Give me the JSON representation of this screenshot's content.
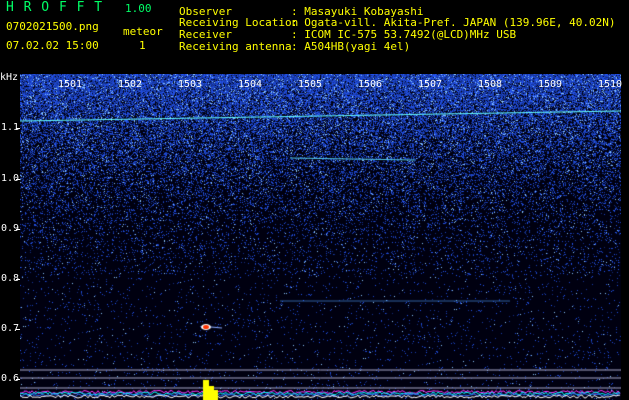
{
  "header": {
    "app_title": "H R O F F T",
    "version": "1.00",
    "filename": "0702021500.png",
    "datetime": "07.02.02 15:00",
    "meteor_label": "meteor",
    "meteor_count": "1",
    "observer_key": "Observer",
    "observer_val": ": Masayuki Kobayashi",
    "location_key": "Receiving Location",
    "location_val": ": Ogata-vill. Akita-Pref. JAPAN (139.96E, 40.02N)",
    "receiver_key": "Receiver",
    "receiver_val": ": ICOM IC-575 53.7492(@LCD)MHz USB",
    "antenna_key": "Receiving antenna",
    "antenna_val": ": A504HB(yagi 4el)"
  },
  "axes": {
    "y_unit": "kHz",
    "y_ticks": [
      "1.1",
      "1.0",
      "0.9",
      "0.8",
      "0.7",
      "0.6"
    ],
    "x_ticks": [
      "1501",
      "1502",
      "1503",
      "1504",
      "1505",
      "1506",
      "1507",
      "1508",
      "1509",
      "1510"
    ]
  },
  "colors": {
    "background": "#000000",
    "spectrum_noise": "#1a3fff",
    "carrier_line": "#66ffff",
    "meteor_echo": "#ff3300",
    "meteor_bar": "#ffff00"
  }
}
